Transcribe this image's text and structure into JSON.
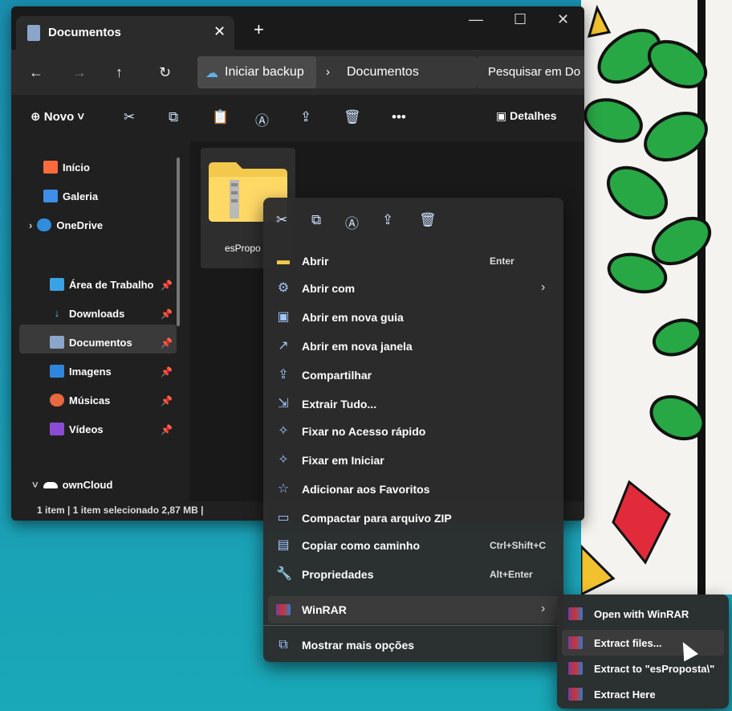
{
  "window": {
    "tab_title": "Documentos",
    "breadcrumb": [
      "Iniciar backup",
      "Documentos"
    ],
    "search_placeholder": "Pesquisar em Do"
  },
  "toolbar": {
    "new_label": "Novo",
    "details_label": "Detalhes"
  },
  "sidebar": {
    "items": [
      {
        "label": "Início",
        "icon": "home-icon"
      },
      {
        "label": "Galeria",
        "icon": "gallery-icon"
      },
      {
        "label": "OneDrive",
        "icon": "cloud-icon"
      },
      {
        "label": "Área de Trabalho",
        "icon": "desktop-icon"
      },
      {
        "label": "Downloads",
        "icon": "download-icon"
      },
      {
        "label": "Documentos",
        "icon": "document-icon"
      },
      {
        "label": "Imagens",
        "icon": "images-icon"
      },
      {
        "label": "Músicas",
        "icon": "music-icon"
      },
      {
        "label": "Vídeos",
        "icon": "video-icon"
      },
      {
        "label": "ownCloud",
        "icon": "cloud-icon"
      }
    ]
  },
  "file": {
    "name": "esPropo"
  },
  "status": {
    "text": "1 item  |  1 item selecionado  2,87 MB  |"
  },
  "context_menu": {
    "items": [
      {
        "label": "Abrir",
        "shortcut": "Enter",
        "icon": "folder-icon"
      },
      {
        "label": "Abrir com",
        "icon": "open-with-icon"
      },
      {
        "label": "Abrir em nova guia",
        "icon": "new-tab-icon"
      },
      {
        "label": "Abrir em nova janela",
        "icon": "new-window-icon"
      },
      {
        "label": "Compartilhar",
        "icon": "share-icon"
      },
      {
        "label": "Extrair Tudo...",
        "icon": "extract-icon"
      },
      {
        "label": "Fixar no Acesso rápido",
        "icon": "pin-icon"
      },
      {
        "label": "Fixar em Iniciar",
        "icon": "pin-icon"
      },
      {
        "label": "Adicionar aos Favoritos",
        "icon": "star-icon"
      },
      {
        "label": "Compactar para arquivo ZIP",
        "icon": "zip-icon"
      },
      {
        "label": "Copiar como caminho",
        "shortcut": "Ctrl+Shift+C",
        "icon": "copy-path-icon"
      },
      {
        "label": "Propriedades",
        "shortcut": "Alt+Enter",
        "icon": "wrench-icon"
      },
      {
        "label": "WinRAR",
        "icon": "winrar-icon"
      },
      {
        "label": "Mostrar mais opções",
        "icon": "more-options-icon"
      }
    ]
  },
  "winrar_submenu": {
    "items": [
      {
        "label": "Open with WinRAR"
      },
      {
        "label": "Extract files..."
      },
      {
        "label": "Extract to \"esProposta\\\""
      },
      {
        "label": "Extract Here"
      }
    ]
  }
}
